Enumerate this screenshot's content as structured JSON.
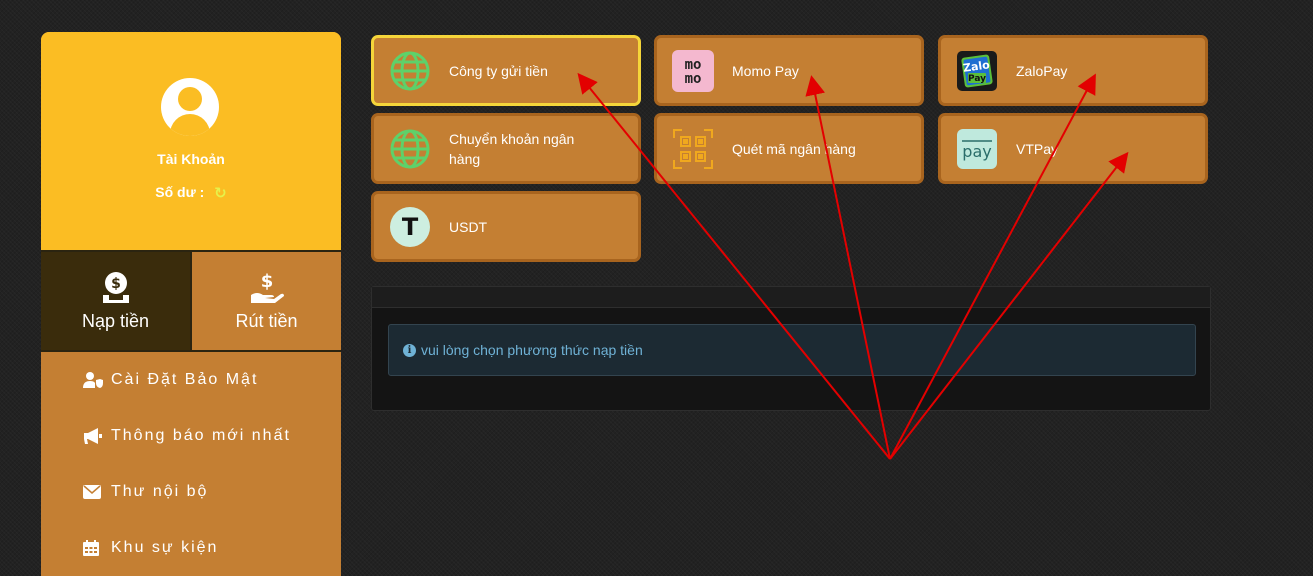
{
  "profile": {
    "account_label": "Tài Khoản",
    "balance_label": "Số dư :"
  },
  "actions": {
    "deposit_label": "Nạp tiền",
    "withdraw_label": "Rút tiền"
  },
  "menu": [
    {
      "label": "Cài Đặt Bảo Mật",
      "icon": "user-shield-icon"
    },
    {
      "label": "Thông báo mới nhất",
      "icon": "megaphone-icon"
    },
    {
      "label": "Thư nội bộ",
      "icon": "envelope-icon"
    },
    {
      "label": "Khu sự kiện",
      "icon": "calendar-icon"
    }
  ],
  "methods": [
    {
      "label": "Công ty gửi tiền",
      "icon": "globe-icon",
      "selected": true
    },
    {
      "label": "Momo Pay",
      "icon": "momo-logo-icon"
    },
    {
      "label": "ZaloPay",
      "icon": "zalopay-logo-icon"
    },
    {
      "label": "Chuyển khoản ngân hàng",
      "icon": "globe-icon"
    },
    {
      "label": "Quét mã ngân hàng",
      "icon": "qr-code-icon"
    },
    {
      "label": "VTPay",
      "icon": "vtpay-logo-icon"
    },
    {
      "label": "USDT",
      "icon": "tether-icon"
    }
  ],
  "notice": {
    "text": "vui lòng chọn phương thức nạp tiền"
  },
  "logos": {
    "momo_text": "mo",
    "zalo_text": "Zalo",
    "zalo_pay_text": "Pay",
    "vt_text": "pay",
    "tether_text": "T"
  },
  "colors": {
    "profile_bg": "#fbbd23",
    "card_bg": "#c47f33",
    "card_selected_border": "#f5d53a",
    "arrow": "#e30000"
  }
}
